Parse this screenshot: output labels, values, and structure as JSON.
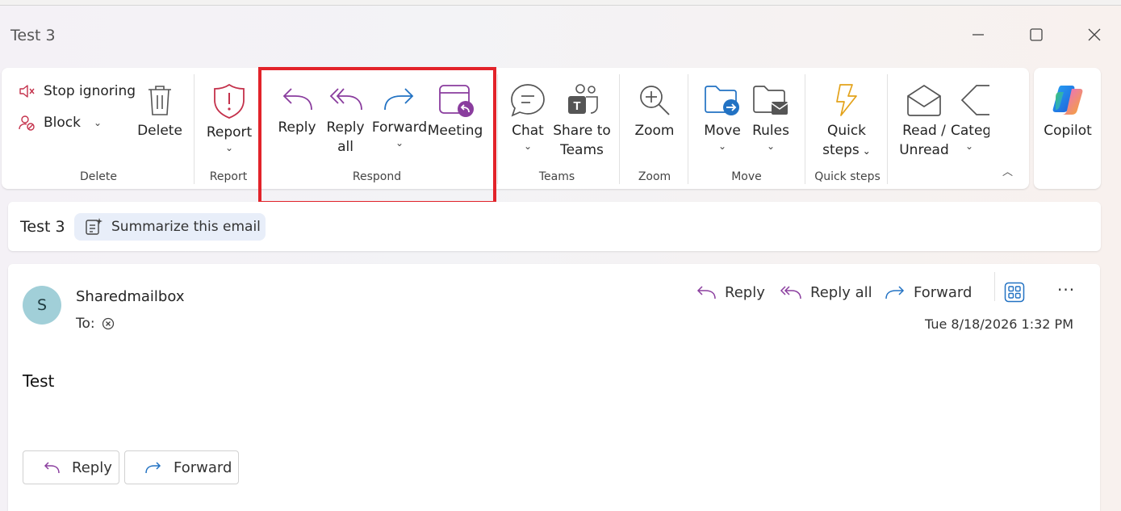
{
  "window": {
    "title": "Test 3"
  },
  "ribbon": {
    "groups": {
      "delete": "Delete",
      "report": "Report",
      "respond": "Respond",
      "teams": "Teams",
      "zoom": "Zoom",
      "move": "Move",
      "quick_steps": "Quick steps"
    },
    "stop_ignoring": "Stop ignoring",
    "block": "Block",
    "delete": "Delete",
    "report": "Report",
    "reply": "Reply",
    "reply_all_1": "Reply",
    "reply_all_2": "all",
    "forward": "Forward",
    "meeting": "Meeting",
    "chat": "Chat",
    "share_teams_1": "Share to",
    "share_teams_2": "Teams",
    "zoom": "Zoom",
    "move": "Move",
    "rules": "Rules",
    "quick_steps_1": "Quick",
    "quick_steps_2": "steps",
    "read_unread_1": "Read /",
    "read_unread_2": "Unread",
    "categorize": "Categ",
    "copilot": "Copilot"
  },
  "subject": {
    "title": "Test 3",
    "summarize": "Summarize this email"
  },
  "message": {
    "avatar_initial": "S",
    "sender": "Sharedmailbox",
    "to_label": "To:",
    "reply": "Reply",
    "reply_all": "Reply all",
    "forward": "Forward",
    "date": "Tue 8/18/2026 1:32 PM",
    "body": "Test",
    "bottom_reply": "Reply",
    "bottom_forward": "Forward"
  },
  "colors": {
    "purple": "#8a3d9e",
    "blue": "#2272c3",
    "red": "#c4314b",
    "highlight": "#e2232a"
  }
}
